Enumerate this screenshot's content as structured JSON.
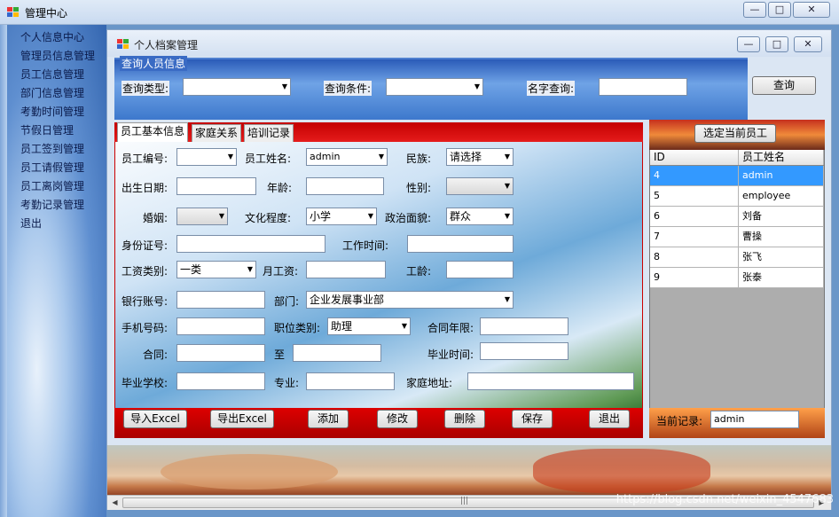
{
  "window": {
    "title": "管理中心",
    "min_label": "—",
    "max_label": "□",
    "close_label": "✕"
  },
  "sidebar": {
    "items": [
      {
        "label": "个人信息中心"
      },
      {
        "label": "管理员信息管理"
      },
      {
        "label": "员工信息管理"
      },
      {
        "label": "部门信息管理"
      },
      {
        "label": "考勤时间管理"
      },
      {
        "label": "节假日管理"
      },
      {
        "label": "员工签到管理"
      },
      {
        "label": "员工请假管理"
      },
      {
        "label": "员工离岗管理"
      },
      {
        "label": "考勤记录管理"
      },
      {
        "label": "退出"
      }
    ]
  },
  "child": {
    "title": "个人档案管理",
    "min_label": "—",
    "max_label": "□",
    "close_label": "✕",
    "query": {
      "group_title": "查询人员信息",
      "type_label": "查询类型:",
      "type_value": "",
      "cond_label": "查询条件:",
      "cond_value": "",
      "name_label": "名字查询:",
      "name_value": "",
      "search_button": "查询"
    },
    "tabs": [
      {
        "label": "员工基本信息"
      },
      {
        "label": "家庭关系"
      },
      {
        "label": "培训记录"
      }
    ],
    "form": {
      "emp_no_label": "员工编号:",
      "emp_no_value": "",
      "emp_name_label": "员工姓名:",
      "emp_name_value": "admin",
      "ethnic_label": "民族:",
      "ethnic_value": "请选择",
      "birth_label": "出生日期:",
      "birth_value": "",
      "age_label": "年龄:",
      "age_value": "",
      "gender_label": "性别:",
      "gender_value": "",
      "marriage_label": "婚姻:",
      "marriage_value": "",
      "edu_label": "文化程度:",
      "edu_value": "小学",
      "politics_label": "政治面貌:",
      "politics_value": "群众",
      "id_label": "身份证号:",
      "id_value": "",
      "worktime_label": "工作时间:",
      "worktime_value": "",
      "salary_type_label": "工资类别:",
      "salary_type_value": "一类",
      "month_salary_label": "月工资:",
      "month_salary_value": "",
      "seniority_label": "工龄:",
      "seniority_value": "",
      "bank_label": "银行账号:",
      "bank_value": "",
      "dept_label": "部门:",
      "dept_value": "企业发展事业部",
      "phone_label": "手机号码:",
      "phone_value": "",
      "post_label": "职位类别:",
      "post_value": "助理",
      "contract_years_label": "合同年限:",
      "contract_years_value": "",
      "contract_label": "合同:",
      "contract_from": "",
      "to_label": "至",
      "contract_to": "",
      "grad_time_label": "毕业时间:",
      "grad_time_value": "",
      "school_label": "毕业学校:",
      "school_value": "",
      "major_label": "专业:",
      "major_value": "",
      "address_label": "家庭地址:",
      "address_value": ""
    },
    "actions": {
      "import": "导入Excel",
      "export": "导出Excel",
      "add": "添加",
      "edit": "修改",
      "delete": "删除",
      "save": "保存",
      "exit": "退出"
    },
    "right": {
      "select_button": "选定当前员工",
      "grid_headers": [
        "ID",
        "员工姓名"
      ],
      "rows": [
        {
          "id": "4",
          "name": "admin"
        },
        {
          "id": "5",
          "name": "employee"
        },
        {
          "id": "6",
          "name": "刘备"
        },
        {
          "id": "7",
          "name": "曹操"
        },
        {
          "id": "8",
          "name": "张飞"
        },
        {
          "id": "9",
          "name": "张泰"
        }
      ],
      "current_label": "当前记录:",
      "current_value": "admin"
    },
    "scroll_grip": "|||"
  },
  "watermark": "https://blog.csdn.net/weixin_4547683"
}
